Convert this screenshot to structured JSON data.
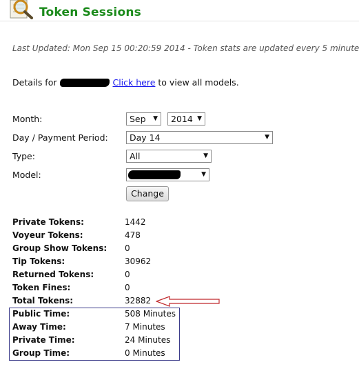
{
  "header": {
    "title": "Token Sessions"
  },
  "last_updated": "Last Updated: Mon Sep 15 00:20:59 2014 - Token stats are updated every 5 minutes",
  "details": {
    "prefix": "Details for",
    "link_text": "Click here",
    "suffix": "to view all models."
  },
  "form": {
    "month_label": "Month:",
    "month_value": "Sep",
    "year_value": "2014",
    "period_label": "Day / Payment Period:",
    "period_value": "Day 14",
    "type_label": "Type:",
    "type_value": "All",
    "model_label": "Model:",
    "submit_label": "Change"
  },
  "stats": [
    {
      "label": "Private Tokens:",
      "value": "1442"
    },
    {
      "label": "Voyeur Tokens:",
      "value": "478"
    },
    {
      "label": "Group Show Tokens:",
      "value": "0"
    },
    {
      "label": "Tip Tokens:",
      "value": "30962"
    },
    {
      "label": "Returned Tokens:",
      "value": "0"
    },
    {
      "label": "Token Fines:",
      "value": "0"
    },
    {
      "label": "Total Tokens:",
      "value": "32882"
    }
  ],
  "times": [
    {
      "label": "Public Time:",
      "value": "508 Minutes"
    },
    {
      "label": "Away Time:",
      "value": "7 Minutes"
    },
    {
      "label": "Private Time:",
      "value": "24 Minutes"
    },
    {
      "label": "Group Time:",
      "value": "0 Minutes"
    }
  ],
  "colors": {
    "title": "#1a8a1a",
    "link": "#1a1aee",
    "annotation_arrow": "#c0282c",
    "box_border": "#3b3b8a"
  },
  "icons": {
    "logo": "magnifier-document-icon",
    "select_arrow": "dropdown-arrow-icon"
  }
}
